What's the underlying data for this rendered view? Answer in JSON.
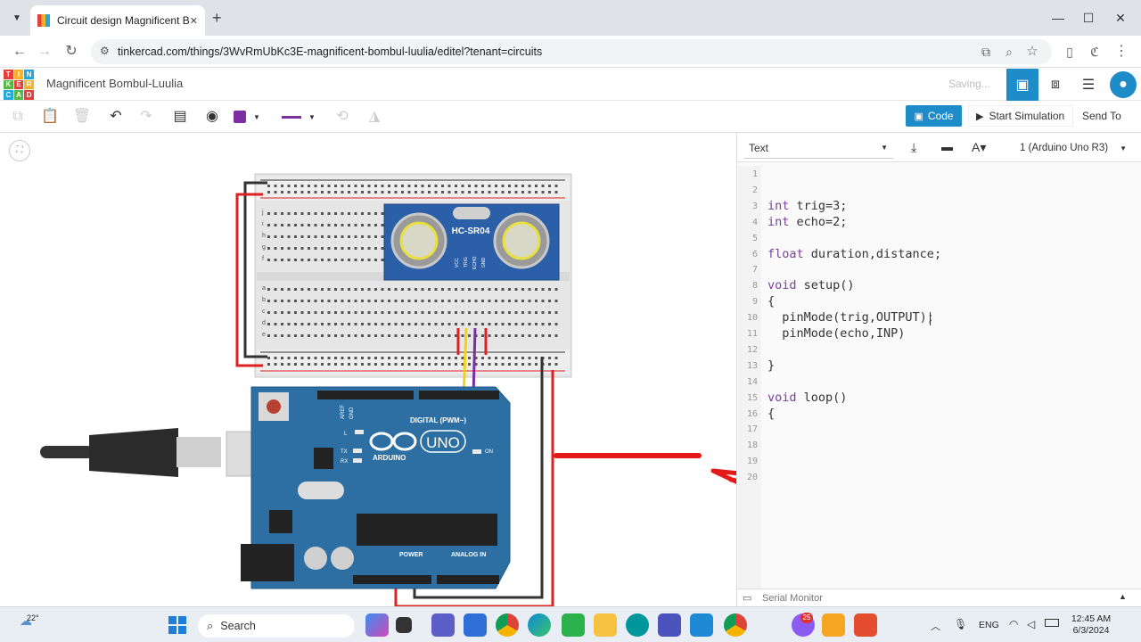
{
  "browser": {
    "tab_title": "Circuit design Magnificent Bom",
    "tab_close": "✕",
    "new_tab": "+",
    "url": "tinkercad.com/things/3WvRmUbKc3E-magnificent-bombul-luulia/editel?tenant=circuits"
  },
  "app": {
    "logo_letters": [
      "TIN",
      "KER",
      "CAD"
    ],
    "project_name": "Magnificent Bombul-Luulia",
    "saving_status": "Saving..."
  },
  "toolbar": {
    "code_label": "Code",
    "start_sim_label": "Start Simulation",
    "send_to_label": "Send To"
  },
  "code_panel": {
    "mode": "Text",
    "device": "1 (Arduino Uno R3)",
    "line_numbers": [
      "1",
      "2",
      "3",
      "4",
      "5",
      "6",
      "7",
      "8",
      "9",
      "10",
      "11",
      "12",
      "13",
      "14",
      "15",
      "16",
      "17",
      "18",
      "19",
      "20"
    ],
    "serial_monitor": "Serial Monitor"
  },
  "code_lines": [
    {
      "kw": "",
      "rest": ""
    },
    {
      "kw": "int",
      "rest": " trig=3;"
    },
    {
      "kw": "int",
      "rest": " echo=2;"
    },
    {
      "kw": "",
      "rest": ""
    },
    {
      "kw": "float",
      "rest": " duration,distance;"
    },
    {
      "kw": "",
      "rest": ""
    },
    {
      "kw": "void",
      "rest": " setup()"
    },
    {
      "kw": "",
      "rest": "{"
    },
    {
      "kw": "",
      "rest": "  pinMode(trig,OUTPUT);"
    },
    {
      "kw": "",
      "rest": "  pinMode(echo,INP)"
    },
    {
      "kw": "",
      "rest": ""
    },
    {
      "kw": "",
      "rest": "}"
    },
    {
      "kw": "",
      "rest": ""
    },
    {
      "kw": "void",
      "rest": " loop()"
    },
    {
      "kw": "",
      "rest": "{"
    }
  ],
  "circuit": {
    "sensor_label": "HC-SR04",
    "sensor_pins": [
      "VCC",
      "TRIG",
      "ECHO",
      "GND"
    ],
    "board_name": "UNO",
    "board_brand": "ARDUINO",
    "digital_label": "DIGITAL (PWM~)",
    "power_label": "POWER",
    "analog_label": "ANALOG IN",
    "aref_label": "AREF",
    "gnd_label": "GND",
    "tx_label": "TX",
    "rx_label": "RX",
    "l_label": "L",
    "on_label": "ON",
    "breadboard_rows_top": [
      "f",
      "g",
      "h",
      "i",
      "j"
    ],
    "breadboard_rows_bottom": [
      "a",
      "b",
      "c",
      "d",
      "e"
    ]
  },
  "taskbar": {
    "weather": "22°",
    "search_label": "Search",
    "lang": "ENG",
    "time": "12:45 AM",
    "date": "6/3/2024",
    "badge": "25"
  },
  "colors": {
    "accent": "#1e8cc8",
    "board": "#2d6fa3",
    "sensor": "#2b5fa8",
    "annotation": "#e41a1a"
  }
}
